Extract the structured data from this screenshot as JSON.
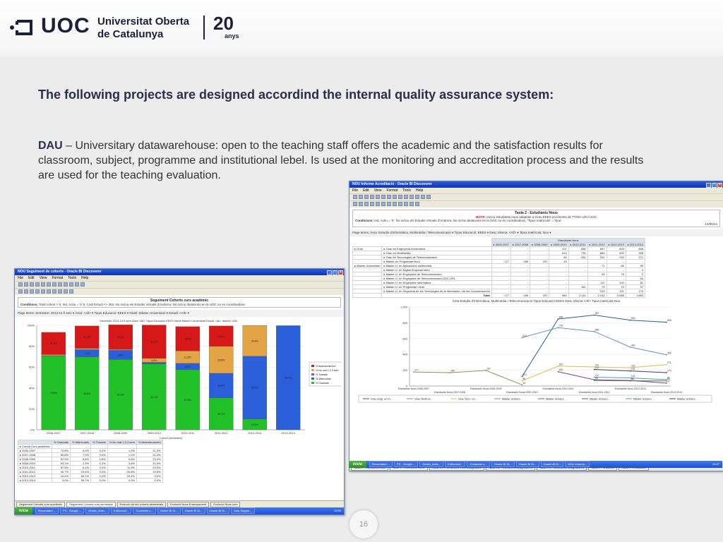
{
  "header": {
    "logo_text": "UOC",
    "university_line1": "Universitat Oberta",
    "university_line2": "de Catalunya",
    "anniversary_number": "20",
    "anniversary_label": "anys"
  },
  "slide": {
    "title": "The following projects are designed accordind the internal quality assurance system:",
    "intro_term": "DAU",
    "intro_rest": " – Universitary datawarehouse: open to the teaching staff offers the academic and the satisfaction results for classroom, subject, programme and institutional lebel. Is used at the monitoring and accreditation process and the results are used for the teaching evaluation.",
    "page_number": "16"
  },
  "left_window": {
    "title": "NOU Seguiment de cohorts - Oracle BI Discoverer",
    "menu": [
      "File",
      "Edit",
      "View",
      "Format",
      "Tools",
      "Help"
    ],
    "report_title": "Seguiment Cohorts curs acadèmic",
    "conditions_label": "Conditions:",
    "conditions_text": "Total cohort > 0, Ind. Actiu = '0' 5, Codi Estudi <> 303, No inclou els Estudis Virtuals d'Andorra, No inclou titulacions en la UOC no es coordinadora",
    "page_items": "Page Items:  Semestre: 2013-14 fi sem ▾   Àrea: <All> ▾   Tipus Educació: EEES ▾   Nivell: Màster Universitari ▾   Estudi: <All> ▾",
    "chart_caption": "Semestre 2013-14 fi sem Àrea <All> Tipus Educació EEES Nivell Màster Universitari Estudi <All> Idioma <All>",
    "x_axis_title": "Cohort (semestre)",
    "table_headers": [
      "",
      "% Graduats",
      "% Matriculats",
      "% Traslats",
      "% No mat 1,2,3 sem",
      "% Abandonament"
    ],
    "table_first_label": "Cohort Curs acadèmic",
    "table_rows": [
      [
        "2006-2007",
        "70,8%",
        "0,0%",
        "0,2%",
        "1,0%",
        "21,3%"
      ],
      [
        "2007-2008",
        "69,8%",
        "7,0%",
        "0,0%",
        "1,2%",
        "21,4%"
      ],
      [
        "2008-2009",
        "67,3%",
        "8,6%",
        "0,6%",
        "0,6%",
        "23,4%"
      ],
      [
        "2009-2010",
        "63,1%",
        "1,3%",
        "0,2%",
        "3,8%",
        "31,9%"
      ],
      [
        "2010-2011",
        "57,5%",
        "6,1%",
        "0,0%",
        "11,9%",
        "23,3%"
      ],
      [
        "2011-2012",
        "30,7%",
        "23,4%",
        "0,0%",
        "25,8%",
        "19,5%"
      ],
      [
        "2012-2013",
        "10,4%",
        "60,1%",
        "0,0%",
        "29,4%",
        "0,0%"
      ],
      [
        "2013-2014",
        "0,0%",
        "99,7%",
        "0,0%",
        "0,0%",
        "0,0%"
      ]
    ],
    "tabs": [
      "Seguiment Cohorts curs acadèmic",
      "Seguiment Cohorts curs semestral",
      "Evolució de les cohorts semestrals",
      "Evolució Nous Ensenyament",
      "Evolució Nous curs"
    ],
    "taskbar": {
      "start": "Inicia",
      "tasks": [
        "Recordatori:...",
        "PS - Google ...",
        "Gestio_Activ...",
        "6 Microsof...",
        "Comentar o...",
        "Oracle BI Di...",
        "Oracle BI Di...",
        "Oracle BI Di...",
        "Acto Segum..."
      ],
      "clock": "13:50"
    }
  },
  "left_chart": {
    "type": "bar",
    "stacked": true,
    "categories": [
      "2006-2007",
      "2007-2008",
      "2008-2009",
      "2009-2010",
      "2010-2011",
      "2011-2012",
      "2012-2013",
      "2013-2014"
    ],
    "series": [
      {
        "name": "% Graduats",
        "color": "#22c12a",
        "values": [
          70.8,
          69.8,
          67.3,
          63.1,
          57.5,
          30.7,
          10.4,
          0.0
        ]
      },
      {
        "name": "% Matriculats",
        "color": "#2a5fd9",
        "values": [
          0.0,
          7.0,
          8.6,
          1.3,
          6.1,
          23.4,
          60.1,
          99.7
        ]
      },
      {
        "name": "% Traslats",
        "color": "#8f4fc2",
        "values": [
          0.2,
          0.0,
          0.6,
          0.2,
          0.0,
          0.0,
          0.0,
          0.0
        ]
      },
      {
        "name": "% No mat 1,2,3 sem",
        "color": "#e3a446",
        "values": [
          1.0,
          1.2,
          0.6,
          3.8,
          11.9,
          25.8,
          29.4,
          0.0
        ]
      },
      {
        "name": "% Abandonament",
        "color": "#d71818",
        "values": [
          21.3,
          21.4,
          23.4,
          31.9,
          23.3,
          19.5,
          0.0,
          0.0
        ]
      }
    ],
    "legend_order": [
      "% Abandonament",
      "% No mat 1,2,3 sem",
      "% Traslats",
      "% Matriculats",
      "% Graduats"
    ],
    "y_ticks": [
      "100%",
      "80%",
      "60%",
      "40%",
      "20%",
      "0%"
    ],
    "ylim": [
      0,
      100
    ],
    "legend": "right"
  },
  "right_window": {
    "title": "NOU Informe Acreditació - Oracle BI Discoverer",
    "menu": [
      "File",
      "Edit",
      "View",
      "Format",
      "Tools",
      "Help"
    ],
    "report_title": "Taula 2 - Estudiants Nous",
    "nota_label": "NOTA:",
    "nota_text": "Inclou estudiants nous adaptats a Grau EEES provinents de TT/HH LRU UOC",
    "conditions_label": "Condicions:",
    "conditions_text": "Ind. Actiu = '0', No inclou els Estudis Virtuals d'Andorra, No inclou titulacions en la UOC no és coordinadora, \"Tipus matrícula\" = 'Nou'",
    "date": "13/05/14",
    "page_items": "Page Items:  Àrea: Estudis d'Informàtica, Multimèdia i Telecomunicació ▾   Tipus Educació: EEES ▾   Desc Idioma: <All> ▾   Tipus matrícula: Nou ▾",
    "table_group_header": "Estudiants Nous",
    "years": [
      "2006-2007",
      "2007-2008",
      "2008-2009",
      "2009-2010",
      "2010-2011",
      "2011-2012",
      "2012-2013",
      "2013-2014"
    ],
    "rows": [
      {
        "group": "Grau",
        "name": "Grau en Enginyeria Informàtica",
        "vals": [
          "-",
          "-",
          "-",
          "121",
          "848",
          "897",
          "833",
          "808"
        ]
      },
      {
        "group": "",
        "name": "Grau en Multimèdia",
        "vals": [
          "-",
          "-",
          "-",
          "613",
          "739",
          "689",
          "492",
          "395"
        ]
      },
      {
        "group": "",
        "name": "Grau en Tecnologies de Telecomunicació",
        "vals": [
          "-",
          "-",
          "-",
          "65",
          "252",
          "241",
          "232",
          "271"
        ]
      },
      {
        "group": "",
        "name": "Màster en Programari lliure",
        "vals": [
          "177",
          "169",
          "197",
          "15",
          "-",
          "-",
          "-",
          "-"
        ]
      },
      {
        "group": "Màster Universitari",
        "name": "Màster U. en Aplicacions multimèdia",
        "vals": [
          "-",
          "-",
          "-",
          "-",
          "-",
          "71",
          "66",
          "65"
        ]
      },
      {
        "group": "",
        "name": "Màster U. en Digital Empowerment",
        "vals": [
          "-",
          "-",
          "-",
          "-",
          "-",
          "-",
          "-",
          "0"
        ]
      },
      {
        "group": "",
        "name": "Màster U. en Enginyeria de Telecomunicació",
        "vals": [
          "-",
          "-",
          "-",
          "-",
          "-",
          "93",
          "79",
          "2"
        ]
      },
      {
        "group": "",
        "name": "Màster U. en Enginyeria de Telecomunicació UOC-URL",
        "vals": [
          "-",
          "-",
          "-",
          "-",
          "-",
          "-",
          "-",
          "54"
        ]
      },
      {
        "group": "",
        "name": "Màster U. en Enginyeria Informàtica",
        "vals": [
          "-",
          "-",
          "-",
          "-",
          "-",
          "112",
          "102",
          "81"
        ]
      },
      {
        "group": "",
        "name": "Màster U. en Programari Lliure",
        "vals": [
          "-",
          "-",
          "-",
          "-",
          "181",
          "79",
          "70",
          "37"
        ]
      },
      {
        "group": "",
        "name": "Màster U. en Seguretat de les Tecnologies de la Informació i de les Comunicacions",
        "vals": [
          "-",
          "-",
          "-",
          "-",
          "-",
          "210",
          "191",
          "170"
        ]
      }
    ],
    "total_label": "Total",
    "totals": [
      "177",
      "169",
      "197",
      "984",
      "2.114",
      "2.410",
      "2.088",
      "1.863"
    ],
    "chart_caption": "Àrea Estudis d'Informàtica, Multimèdia i Telecomunicació Tipus Educació EEES Desc Idioma <All> Tipus matrícula Nou",
    "tabs": [
      "Taula 1 - Estudiants nous",
      "Taula 2 - Estudiants Nous",
      "Taula 4.1 - Rendiment i èxit assignatura",
      "Taula 4.2 - Indicadors assignatures",
      "Taula 4.3 - Satisfacció assignatures",
      "Taula 5 - Graduats",
      "Taula 6 - Graduació"
    ],
    "taskbar": {
      "start": "Inicia",
      "tasks": [
        "Recordatori:...",
        "PS - Google ...",
        "Gestio_Activ...",
        "6 Microsof...",
        "Comentar o...",
        "Oracle BI Di...",
        "Oracle BI Di...",
        "Oracle BI Di...",
        "NOU Informe..."
      ],
      "clock": "13:47"
    }
  },
  "right_chart": {
    "type": "line",
    "x": [
      "2006-2007",
      "2007-2008",
      "2008-2009",
      "2009-2010",
      "2010-2011",
      "2011-2012",
      "2012-2013",
      "2013-2014"
    ],
    "x_tick_labels": [
      "Estudiants Nous,2006-2007",
      "Estudiants Nous,2007-2008",
      "Estudiants Nous,2008-2009",
      "Estudiants Nous,2009-2010",
      "Estudiants Nous,2010-2011",
      "Estudiants Nous,2011-2012",
      "Estudiants Nous,2012-2013",
      "Estudiants Nous,2013-2014"
    ],
    "y_ticks": [
      0,
      200,
      400,
      600,
      800,
      1000
    ],
    "ylim": [
      0,
      1000
    ],
    "series": [
      {
        "name": "Grau Enginyeria Informàtica",
        "legend_label": "Grau Engi. en In...",
        "color": "#2a5f8f",
        "values": [
          null,
          null,
          null,
          121,
          848,
          897,
          833,
          808
        ]
      },
      {
        "name": "Grau Multimèdia",
        "legend_label": "Grau Multi en...",
        "color": "#6b8fb5",
        "values": [
          null,
          null,
          null,
          613,
          739,
          689,
          492,
          395
        ]
      },
      {
        "name": "Grau Tecnologies de Telecomunicació",
        "legend_label": "Grau Tecn. en...",
        "color": "#d6c04a",
        "values": [
          null,
          null,
          null,
          65,
          252,
          241,
          232,
          271
        ]
      },
      {
        "name": "Màster Programari lliure",
        "legend_label": "Màster Univers...",
        "color": "#9a8a5a",
        "values": [
          177,
          169,
          197,
          15,
          null,
          null,
          null,
          null
        ]
      },
      {
        "name": "Màster U. Aplicacions multimèdia",
        "legend_label": "Màster Univers...",
        "color": "#5c7a2e",
        "values": [
          null,
          null,
          null,
          null,
          null,
          71,
          66,
          65
        ]
      },
      {
        "name": "Màster U. Programari Lliure",
        "legend_label": "Màster Univers...",
        "color": "#7f3f8a",
        "values": [
          null,
          null,
          null,
          null,
          181,
          79,
          70,
          37
        ]
      },
      {
        "name": "Màster U. Enginyeria Informàtica",
        "legend_label": "Màster Univers...",
        "color": "#3fa2b5",
        "values": [
          null,
          null,
          null,
          null,
          null,
          112,
          102,
          81
        ]
      },
      {
        "name": "Màster U. Seguretat TIC",
        "legend_label": "Màster Univers...",
        "color": "#3a3a7a",
        "values": [
          null,
          null,
          null,
          null,
          null,
          210,
          191,
          170
        ]
      }
    ],
    "legend": "bottom"
  }
}
